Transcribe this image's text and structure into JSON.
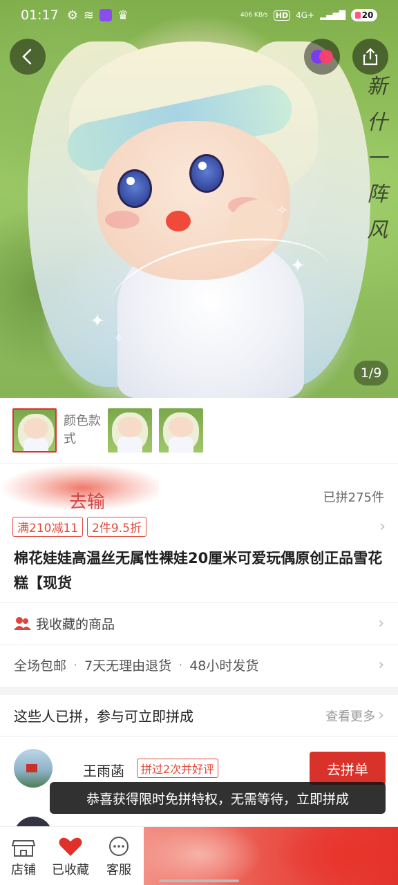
{
  "status_bar": {
    "time": "01:17",
    "net_speed": "406 KB/s",
    "hd": "HD",
    "signal": "4G+",
    "battery": "20"
  },
  "gallery": {
    "page_indicator": "1/9",
    "deco_text": "新什一阵风"
  },
  "thumbs": {
    "label": "颜色款式"
  },
  "price": {
    "blurred_text": "去输",
    "sold": "已拼275件"
  },
  "promos": [
    "满210减11",
    "2件9.5折"
  ],
  "product": {
    "title": "棉花娃娃高温丝无属性裸娃20厘米可爱玩偶原创正品雪花糕【现货"
  },
  "favorites_row": {
    "label": "我收藏的商品"
  },
  "services": [
    "全场包邮",
    "7天无理由退货",
    "48小时发货"
  ],
  "group_buy": {
    "heading": "这些人已拼，参与可立即拼成",
    "more": "查看更多",
    "user": {
      "name": "王雨菡",
      "tag": "拼过2次并好评",
      "button": "去拼单"
    }
  },
  "toast": "恭喜获得限时免拼特权，无需等待，立即拼成",
  "bottom_bar": {
    "shop": "店铺",
    "fav": "已收藏",
    "service": "客服"
  },
  "colors": {
    "accent": "#d8322a",
    "promo": "#e24a3a"
  }
}
